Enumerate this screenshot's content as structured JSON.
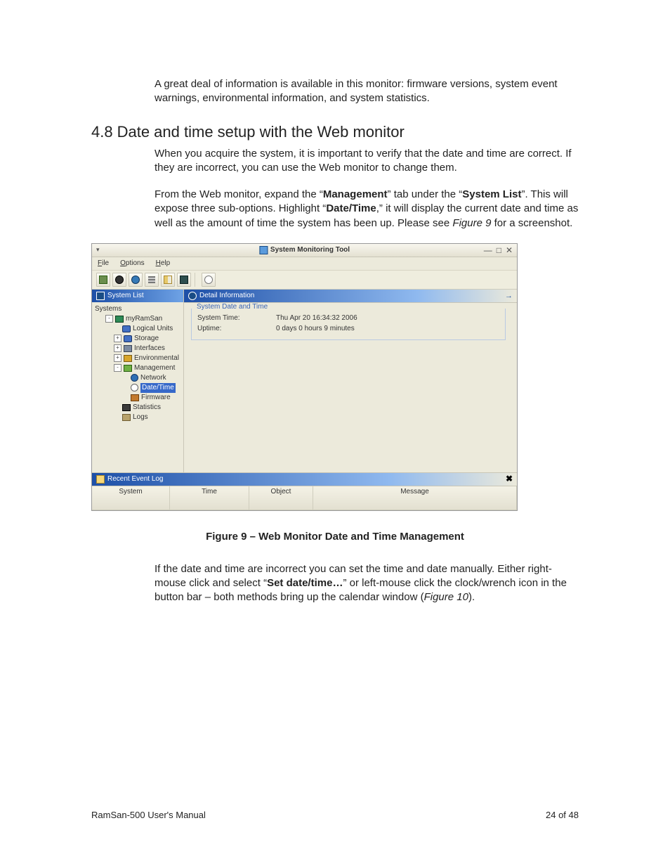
{
  "paragraphs": {
    "intro": "A great deal of information is available in this monitor: firmware versions, system event warnings, environmental information, and system statistics.",
    "p1": "When you acquire the system, it is important to verify that the date and time are correct.  If they are incorrect, you can use the Web monitor to change them.",
    "p2_pre": "From the Web monitor, expand the “",
    "p2_b1": "Management",
    "p2_mid1": "” tab under the “",
    "p2_b2": "System List",
    "p2_mid2": "”.  This will expose three sub-options.  Highlight “",
    "p2_b3": "Date/Time",
    "p2_mid3": ",” it will display the current date and time as well as the amount of time the system has been up.  Please see ",
    "p2_i": "Figure 9",
    "p2_end": " for a screenshot.",
    "p3_pre": "If the date and time are incorrect you can set the time and date manually.  Either right-mouse click and select “",
    "p3_b": "Set date/time…",
    "p3_mid": "” or left-mouse click the clock/wrench icon in the button bar – both methods bring up the calendar window (",
    "p3_i": "Figure 10",
    "p3_end": ")."
  },
  "section": {
    "num": "4.8",
    "title": "Date and time setup with the Web monitor"
  },
  "figure_caption": "Figure 9 – Web Monitor Date and Time Management",
  "footer": {
    "left": "RamSan-500 User's Manual",
    "right": "24 of 48"
  },
  "window": {
    "title": "System Monitoring Tool",
    "menus": {
      "file": "File",
      "options": "Options",
      "help": "Help"
    },
    "sidebar": {
      "title": "System List",
      "root": "Systems"
    },
    "tree": {
      "myramsan": "myRamSan",
      "logical_units": "Logical Units",
      "storage": "Storage",
      "interfaces": "Interfaces",
      "environmental": "Environmental",
      "management": "Management",
      "network": "Network",
      "datetime": "Date/Time",
      "firmware": "Firmware",
      "statistics": "Statistics",
      "logs": "Logs"
    },
    "detail": {
      "title": "Detail Information",
      "group": "System Date and Time",
      "system_time_label": "System Time:",
      "system_time_value": "Thu Apr 20 16:34:32 2006",
      "uptime_label": "Uptime:",
      "uptime_value": "0 days  0 hours  9 minutes"
    },
    "eventlog": {
      "title": "Recent Event Log",
      "cols": {
        "system": "System",
        "time": "Time",
        "object": "Object",
        "message": "Message"
      }
    }
  }
}
